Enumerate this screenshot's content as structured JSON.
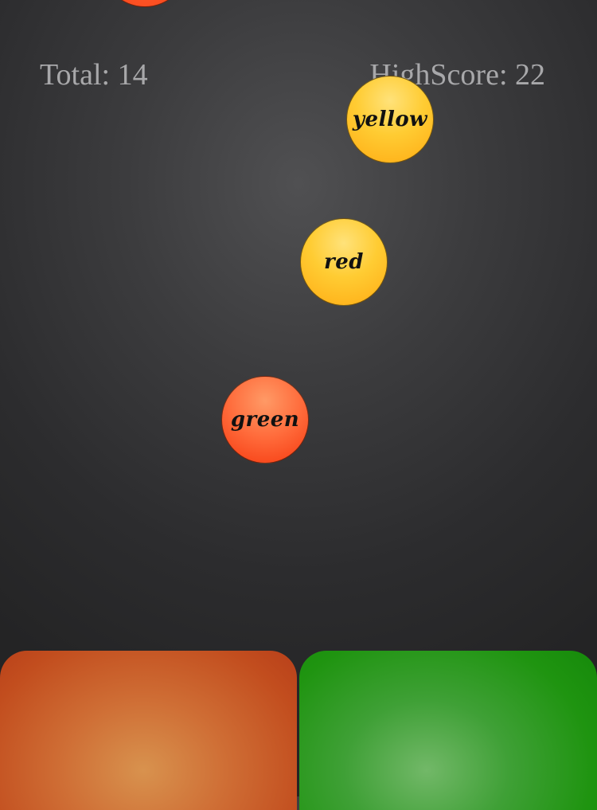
{
  "hud": {
    "total_label": "Total: 14",
    "highscore_label": "HighScore: 22"
  },
  "balls": [
    {
      "word": "yellow",
      "color": "#ffc42a"
    },
    {
      "word": "red",
      "color": "#ffc42a"
    },
    {
      "word": "green",
      "color": "#ff5a2a"
    }
  ],
  "offscreen_ball": {
    "color": "#f43a12"
  },
  "pads": [
    {
      "name": "orange",
      "color": "#c95a28"
    },
    {
      "name": "green",
      "color": "#23961a"
    }
  ]
}
